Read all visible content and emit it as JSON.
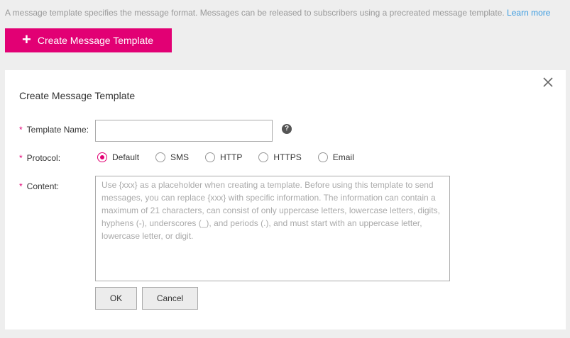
{
  "intro": {
    "text": "A message template specifies the message format. Messages can be released to subscribers using a precreated message template.",
    "link": "Learn more"
  },
  "create_button": {
    "icon": "plus-icon",
    "label": "Create Message Template"
  },
  "dialog": {
    "title": "Create Message Template",
    "close_icon": "close-icon",
    "required_mark": "*",
    "fields": {
      "name": {
        "label": "Template Name:",
        "value": "",
        "placeholder": ""
      },
      "protocol": {
        "label": "Protocol:",
        "selected": "Default",
        "options": [
          "Default",
          "SMS",
          "HTTP",
          "HTTPS",
          "Email"
        ]
      },
      "content": {
        "label": "Content:",
        "value": "",
        "placeholder": "Use {xxx} as a placeholder when creating a template. Before using this template to send messages, you can replace {xxx} with specific information. The information can contain a maximum of 21 characters, can consist of only uppercase letters, lowercase letters, digits, hyphens (-), underscores (_), and periods (.), and must start with an uppercase letter, lowercase letter, or digit."
      }
    },
    "help_icon": "question-circle-icon",
    "help_glyph": "?",
    "ok_label": "OK",
    "cancel_label": "Cancel"
  },
  "colors": {
    "accent": "#e20074",
    "link": "#3c9ce0",
    "background": "#eeeeee"
  }
}
